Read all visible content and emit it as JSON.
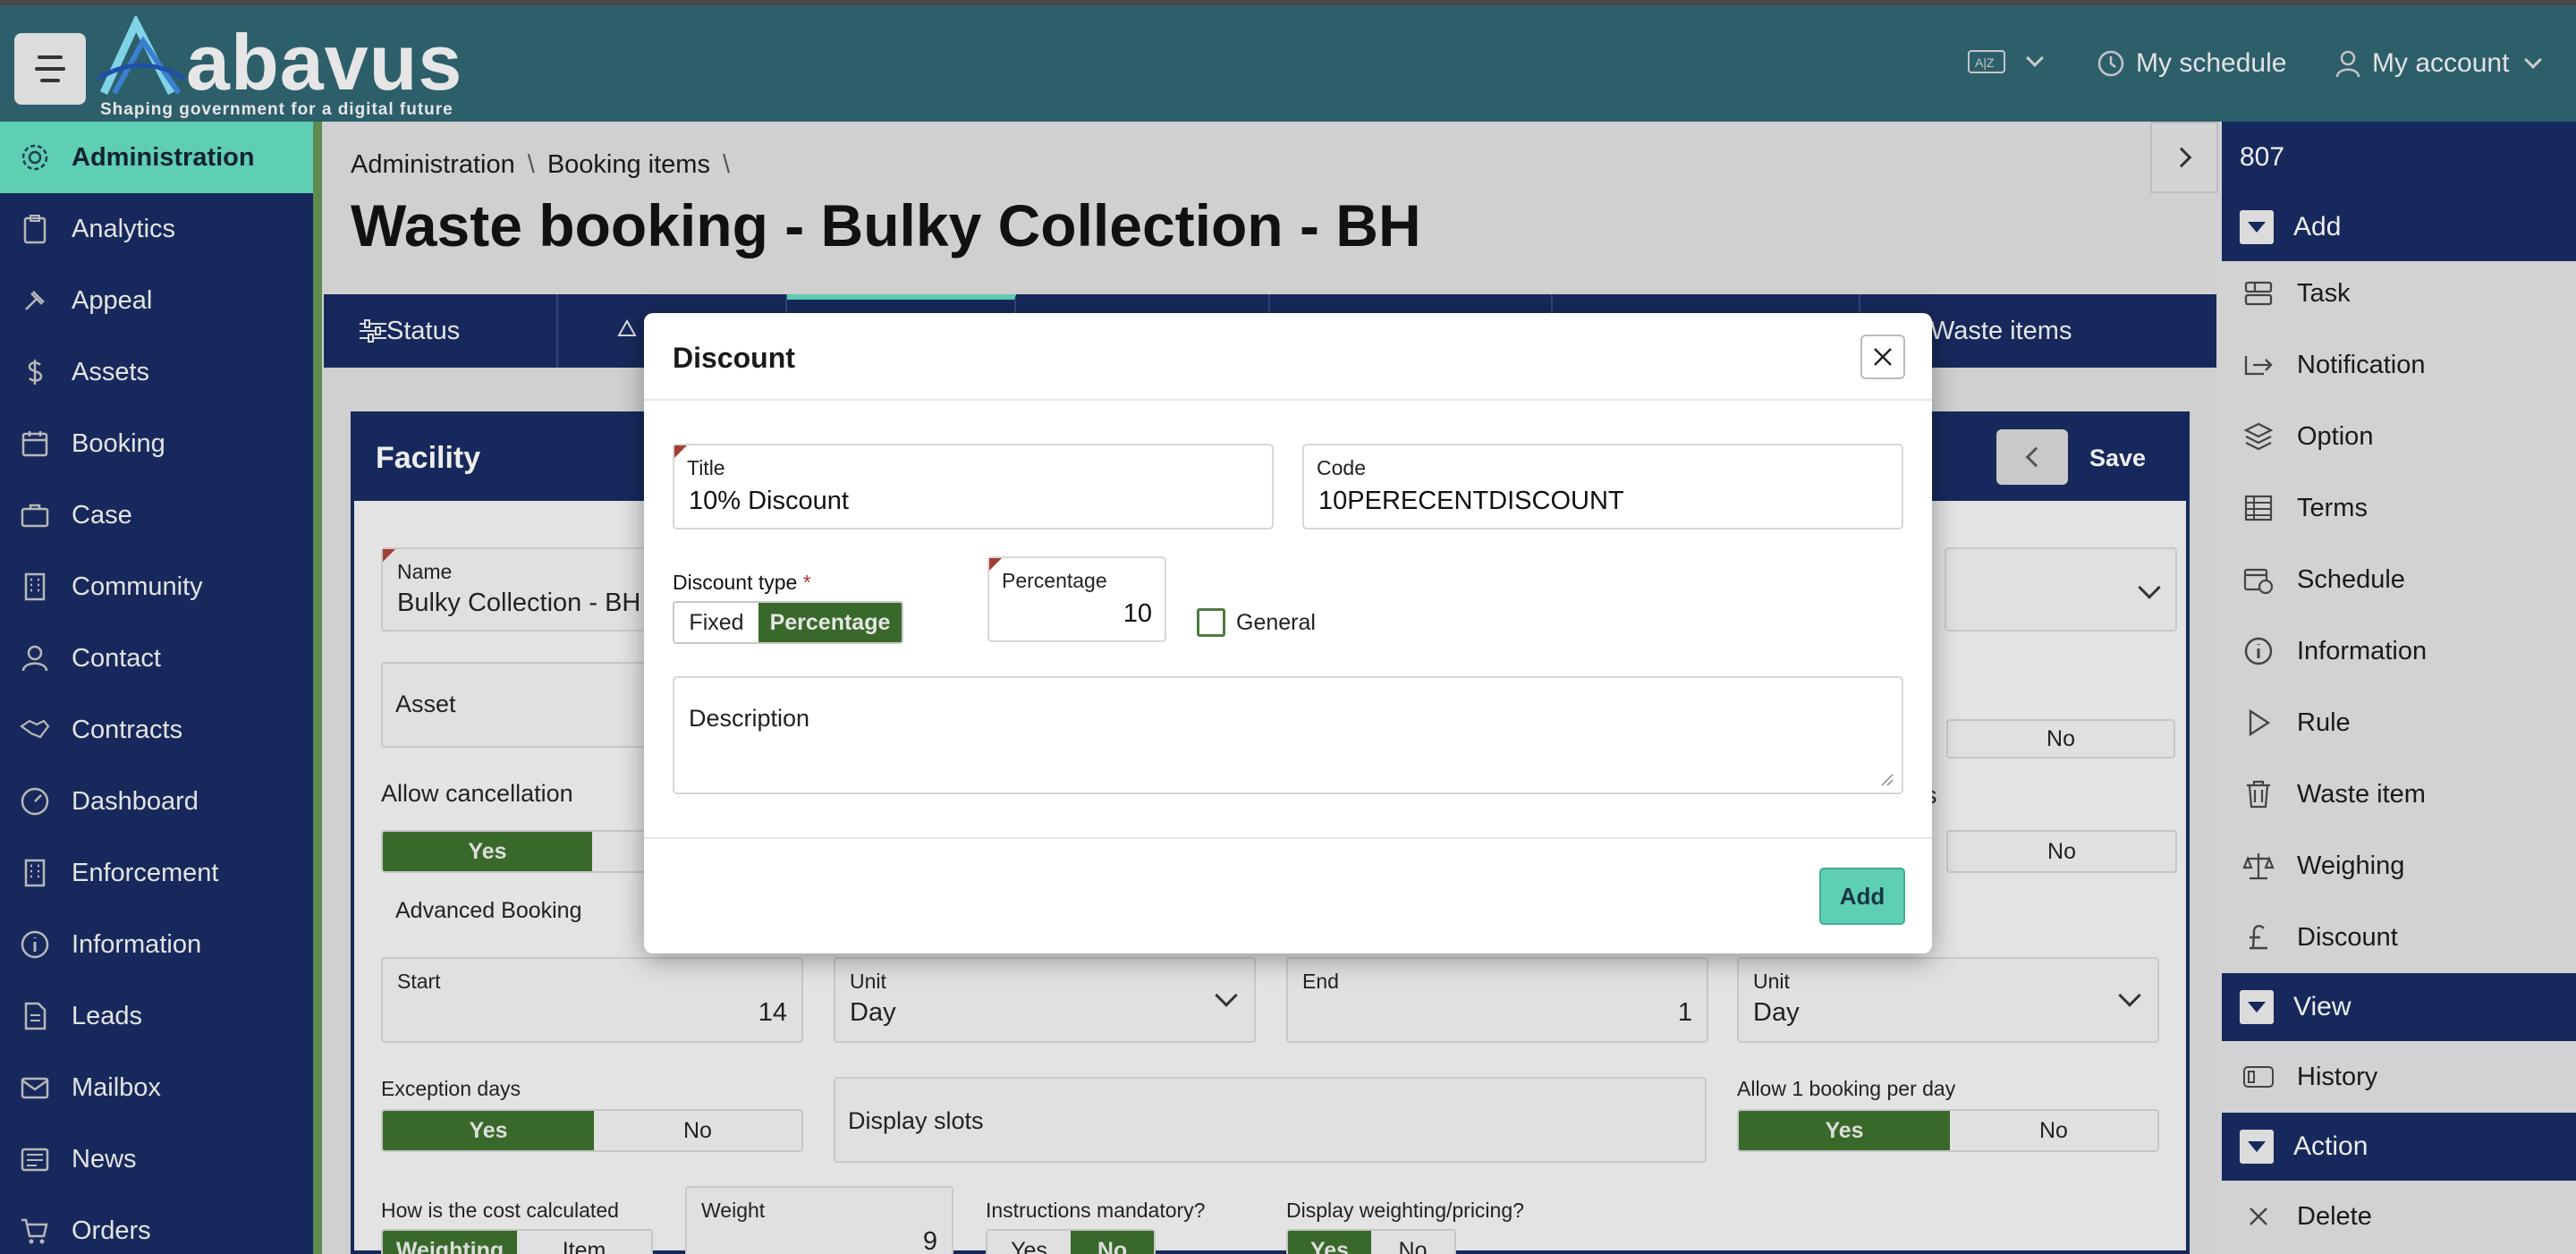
{
  "app": {
    "brand": "abavus",
    "tagline": "Shaping government for a digital future"
  },
  "header": {
    "schedule_label": "My schedule",
    "account_label": "My account"
  },
  "sidebar": {
    "items": [
      {
        "label": "Administration",
        "icon": "gear-icon",
        "active": true
      },
      {
        "label": "Analytics",
        "icon": "clipboard-icon"
      },
      {
        "label": "Appeal",
        "icon": "gavel-icon"
      },
      {
        "label": "Assets",
        "icon": "dollar-icon"
      },
      {
        "label": "Booking",
        "icon": "calendar-icon"
      },
      {
        "label": "Case",
        "icon": "briefcase-icon"
      },
      {
        "label": "Community",
        "icon": "building-icon"
      },
      {
        "label": "Contact",
        "icon": "user-icon"
      },
      {
        "label": "Contracts",
        "icon": "handshake-icon"
      },
      {
        "label": "Dashboard",
        "icon": "gauge-icon"
      },
      {
        "label": "Enforcement",
        "icon": "building-icon"
      },
      {
        "label": "Information",
        "icon": "info-icon"
      },
      {
        "label": "Leads",
        "icon": "document-icon"
      },
      {
        "label": "Mailbox",
        "icon": "mail-icon"
      },
      {
        "label": "News",
        "icon": "news-icon"
      },
      {
        "label": "Orders",
        "icon": "cart-icon"
      }
    ]
  },
  "breadcrumb": [
    "Administration",
    "Booking items"
  ],
  "page_title": "Waste booking - Bulky Collection - BH",
  "tabs": {
    "status": "Status",
    "waste_items": "Waste items"
  },
  "facility": {
    "header": "Facility",
    "save_label": "Save",
    "name_label": "Name",
    "name_value": "Bulky Collection - BH",
    "asset_label": "Asset",
    "no_label": "No",
    "yes_label": "Yes",
    "allow_cancellation": "Allow cancellation",
    "partial_s": "s",
    "advanced_booking": "Advanced Booking",
    "start_label": "Start",
    "start_value": "14",
    "unit_label": "Unit",
    "unit_value": "Day",
    "end_label": "End",
    "end_value": "1",
    "unit2_label": "Unit",
    "unit2_value": "Day",
    "exception_days": "Exception days",
    "display_slots": "Display slots",
    "allow_one_booking": "Allow 1 booking per day",
    "cost_calc": "How is the cost calculated",
    "weighting": "Weighting",
    "item": "Item",
    "weight_label": "Weight",
    "weight_value": "9",
    "instructions_mandatory": "Instructions mandatory?",
    "display_weighting": "Display weighting/pricing?"
  },
  "right_panel": {
    "record_id": "807",
    "add_section": "Add",
    "add_items": [
      {
        "label": "Task",
        "icon": "task-icon"
      },
      {
        "label": "Notification",
        "icon": "share-icon"
      },
      {
        "label": "Option",
        "icon": "layers-icon"
      },
      {
        "label": "Terms",
        "icon": "table-icon"
      },
      {
        "label": "Schedule",
        "icon": "calendar-clock-icon"
      },
      {
        "label": "Information",
        "icon": "info-icon"
      },
      {
        "label": "Rule",
        "icon": "play-icon"
      },
      {
        "label": "Waste item",
        "icon": "trash-icon"
      },
      {
        "label": "Weighing",
        "icon": "scale-icon"
      },
      {
        "label": "Discount",
        "icon": "pound-icon"
      }
    ],
    "view_section": "View",
    "view_items": [
      {
        "label": "History",
        "icon": "history-icon"
      }
    ],
    "action_section": "Action",
    "action_items": [
      {
        "label": "Delete",
        "icon": "close-icon"
      }
    ]
  },
  "modal": {
    "title": "Discount",
    "title_field_label": "Title",
    "title_field_value": "10% Discount",
    "code_label": "Code",
    "code_value": "10PERECENTDISCOUNT",
    "discount_type_label": "Discount type",
    "required_mark": "*",
    "fixed_label": "Fixed",
    "percentage_option": "Percentage",
    "percentage_label": "Percentage",
    "percentage_value": "10",
    "general_label": "General",
    "description_placeholder": "Description",
    "add_label": "Add"
  },
  "colors": {
    "navy": "#17295c",
    "teal": "#2d5f6b",
    "accent": "#5fcfb3",
    "green": "#39692a"
  }
}
